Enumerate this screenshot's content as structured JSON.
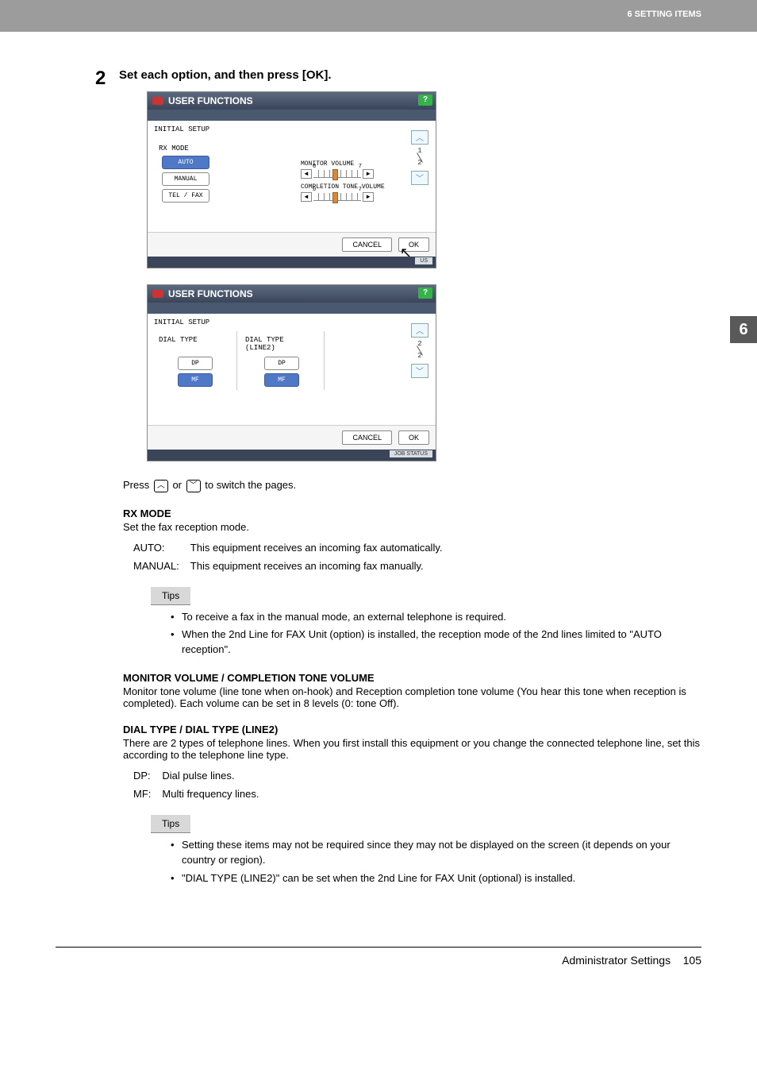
{
  "header": {
    "section": "6 SETTING ITEMS",
    "tab": "6"
  },
  "step": {
    "num": "2",
    "title": "Set each option, and then press [OK]."
  },
  "screen1": {
    "title": "USER FUNCTIONS",
    "breadcrumb": "INITIAL SETUP",
    "rx_mode": {
      "label": "RX MODE",
      "options": {
        "auto": "AUTO",
        "manual": "MANUAL",
        "telfax": "TEL / FAX"
      }
    },
    "monitor_volume": {
      "label": "MONITOR VOLUME",
      "min": "0",
      "max": "7"
    },
    "completion_volume": {
      "label": "COMPLETION TONE VOLUME",
      "min": "0",
      "max": "7"
    },
    "pager": {
      "top": "1",
      "bottom": "2"
    },
    "buttons": {
      "cancel": "CANCEL",
      "ok": "OK"
    },
    "jobstatus_badge": "US"
  },
  "screen2": {
    "title": "USER FUNCTIONS",
    "breadcrumb": "INITIAL SETUP",
    "dial_type": {
      "label": "DIAL TYPE",
      "dp": "DP",
      "mf": "MF"
    },
    "dial_type_line2": {
      "label": "DIAL TYPE\n(LINE2)",
      "dp": "DP",
      "mf": "MF"
    },
    "pager": {
      "top": "2",
      "bottom": "2"
    },
    "buttons": {
      "cancel": "CANCEL",
      "ok": "OK"
    },
    "jobstatus": "JOB STATUS"
  },
  "press_switch": {
    "pre": "Press ",
    "mid": " or ",
    "post": " to switch the pages."
  },
  "rx_mode_section": {
    "heading": "RX MODE",
    "desc": "Set the fax reception mode.",
    "auto_label": "AUTO:",
    "auto_text": "This equipment receives an incoming fax automatically.",
    "manual_label": "MANUAL:",
    "manual_text": "This equipment receives an incoming fax manually."
  },
  "tips1": {
    "label": "Tips",
    "items": [
      "To receive a fax in the manual mode, an external telephone is required.",
      "When the 2nd Line for FAX Unit (option) is installed, the reception mode of the 2nd lines limited to \"AUTO reception\"."
    ]
  },
  "monitor_section": {
    "heading": "MONITOR VOLUME / COMPLETION TONE VOLUME",
    "desc": "Monitor tone volume (line tone when on-hook) and Reception completion tone volume (You hear this tone when reception is completed). Each volume can be set in 8 levels (0: tone Off)."
  },
  "dial_section": {
    "heading": "DIAL TYPE / DIAL TYPE (LINE2)",
    "desc": "There are 2 types of telephone lines. When you first install this equipment or you change the connected telephone line, set this according to the telephone line type.",
    "dp_label": "DP:",
    "dp_text": "Dial pulse lines.",
    "mf_label": "MF:",
    "mf_text": "Multi frequency lines."
  },
  "tips2": {
    "label": "Tips",
    "items": [
      "Setting these items may not be required since they may not be displayed on the screen (it depends on your country or region).",
      "\"DIAL TYPE (LINE2)\" can be set when the 2nd Line for FAX Unit (optional) is installed."
    ]
  },
  "footer": {
    "section": "Administrator Settings",
    "page": "105"
  }
}
